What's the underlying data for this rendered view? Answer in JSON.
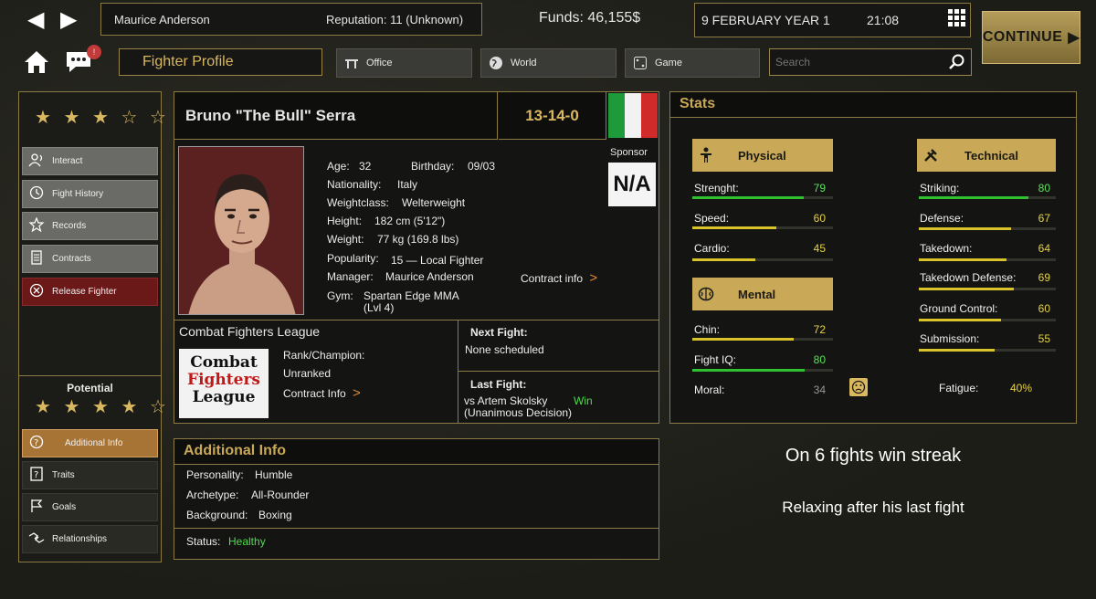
{
  "topbar": {
    "manager_name": "Maurice Anderson",
    "reputation": "Reputation: 11 (Unknown)",
    "funds": "Funds: 46,155$",
    "date": "9 FEBRUARY YEAR 1",
    "time": "21:08",
    "continue_label": "CONTINUE",
    "notification_count": "!"
  },
  "nav": {
    "current_page": "Fighter Profile",
    "office": "Office",
    "world": "World",
    "game": "Game",
    "search_placeholder": "Search"
  },
  "sidebar": {
    "rating_stars": "★ ★ ★ ☆ ☆",
    "items": [
      "Interact",
      "Fight History",
      "Records",
      "Contracts",
      "Release Fighter"
    ],
    "potential_label": "Potential",
    "potential_stars": "★ ★ ★ ★ ☆",
    "sub_items": [
      "Additional Info",
      "Traits",
      "Goals",
      "Relationships"
    ]
  },
  "fighter": {
    "name": "Bruno \"The Bull\" Serra",
    "record": "13-14-0",
    "sponsor_label": "Sponsor",
    "sponsor_value": "N/A",
    "age_label": "Age:",
    "age": "32",
    "birthday_label": "Birthday:",
    "birthday": "09/03",
    "nationality_label": "Nationality:",
    "nationality": "Italy",
    "weightclass_label": "Weightclass:",
    "weightclass": "Welterweight",
    "height_label": "Height:",
    "height": "182 cm (5'12\")",
    "weight_label": "Weight:",
    "weight": "77 kg (169.8 lbs)",
    "popularity_label": "Popularity:",
    "popularity": "15 — Local Fighter",
    "manager_label": "Manager:",
    "manager": "Maurice Anderson",
    "contract_info": "Contract info",
    "gym_label": "Gym:",
    "gym_line1": "Spartan Edge MMA",
    "gym_line2": "(Lvl 4)"
  },
  "league": {
    "name": "Combat Fighters League",
    "logo_line1": "Combat",
    "logo_line2": "Fighters",
    "logo_line3": "League",
    "rank_label": "Rank/Champion:",
    "rank_value": "Unranked",
    "contract_info": "Contract Info"
  },
  "fights": {
    "next_label": "Next Fight:",
    "next_value": "None scheduled",
    "last_label": "Last Fight:",
    "last_opponent": "vs Artem Skolsky",
    "last_result": "Win",
    "last_method": "(Unanimous Decision)"
  },
  "additional": {
    "title": "Additional Info",
    "personality_label": "Personality:",
    "personality": "Humble",
    "archetype_label": "Archetype:",
    "archetype": "All-Rounder",
    "background_label": "Background:",
    "background": "Boxing",
    "status_label": "Status:",
    "status": "Healthy"
  },
  "stats": {
    "title": "Stats",
    "physical_title": "Physical",
    "technical_title": "Technical",
    "mental_title": "Mental",
    "physical": [
      {
        "label": "Strenght:",
        "value": "79",
        "level": 0.79,
        "color": "#2fc12f"
      },
      {
        "label": "Speed:",
        "value": "60",
        "level": 0.6,
        "color": "#d8c42a"
      },
      {
        "label": "Cardio:",
        "value": "45",
        "level": 0.45,
        "color": "#d8c42a"
      }
    ],
    "technical": [
      {
        "label": "Striking:",
        "value": "80",
        "level": 0.8,
        "color": "#2fc12f"
      },
      {
        "label": "Defense:",
        "value": "67",
        "level": 0.67,
        "color": "#d8c42a"
      },
      {
        "label": "Takedown:",
        "value": "64",
        "level": 0.64,
        "color": "#d8c42a"
      },
      {
        "label": "Takedown Defense:",
        "value": "69",
        "level": 0.69,
        "color": "#d8c42a"
      },
      {
        "label": "Ground Control:",
        "value": "60",
        "level": 0.6,
        "color": "#d8c42a"
      },
      {
        "label": "Submission:",
        "value": "55",
        "level": 0.55,
        "color": "#d8c42a"
      }
    ],
    "mental": [
      {
        "label": "Chin:",
        "value": "72",
        "level": 0.72,
        "color": "#d8c42a"
      },
      {
        "label": "Fight IQ:",
        "value": "80",
        "level": 0.8,
        "color": "#2fc12f"
      }
    ],
    "moral_label": "Moral:",
    "moral_value": "34",
    "fatigue_label": "Fatigue:",
    "fatigue_value": "40%"
  },
  "status_messages": {
    "streak": "On 6 fights win streak",
    "mood": "Relaxing after his last fight"
  }
}
